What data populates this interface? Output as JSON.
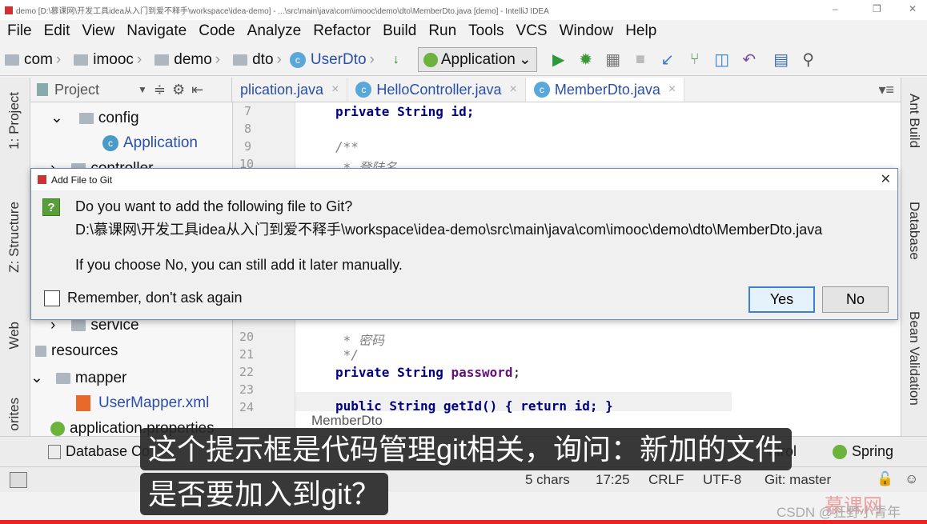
{
  "window": {
    "title": "demo [D:\\慕课网\\开发工具idea从入门到爱不释手\\workspace\\idea-demo] - ...\\src\\main\\java\\com\\imooc\\demo\\dto\\MemberDto.java [demo] - IntelliJ IDEA"
  },
  "menu": [
    "File",
    "Edit",
    "View",
    "Navigate",
    "Code",
    "Analyze",
    "Refactor",
    "Build",
    "Run",
    "Tools",
    "VCS",
    "Window",
    "Help"
  ],
  "breadcrumbs": [
    "com",
    "imooc",
    "demo",
    "dto",
    "UserDto"
  ],
  "run_config": "Application",
  "project_panel": {
    "label": "Project"
  },
  "tabs": [
    {
      "label": "plication.java"
    },
    {
      "label": "HelloController.java"
    },
    {
      "label": "MemberDto.java",
      "active": true
    }
  ],
  "left_stripe": [
    "1: Project",
    "Z: Structure",
    "Web",
    "orites"
  ],
  "right_stripe": [
    "Ant Build",
    "Database",
    "Bean Validation"
  ],
  "tree": [
    {
      "label": "config",
      "kind": "folder"
    },
    {
      "label": "Application",
      "kind": "class"
    },
    {
      "label": "controller",
      "kind": "folder"
    },
    {
      "label": "service",
      "kind": "folder"
    },
    {
      "label": "resources",
      "kind": "folder"
    },
    {
      "label": "mapper",
      "kind": "folder"
    },
    {
      "label": "UserMapper.xml",
      "kind": "xml"
    },
    {
      "label": "application.properties",
      "kind": "properties"
    }
  ],
  "code": {
    "lines": [
      "7",
      "8",
      "9",
      "10",
      "20",
      "21",
      "22",
      "23",
      "24"
    ],
    "l7": "private String id;",
    "l9": "/**",
    "l10": " * 登陆名",
    "l20": " * 密码",
    "l21": " */",
    "l22a": "private String ",
    "l22b": "password",
    ";": ";",
    "l24": "public String getId() { return id; }",
    "breadcrumb": "MemberDto"
  },
  "dialog": {
    "title": "Add File to Git",
    "question": "Do you want to add the following file to Git?",
    "path": "D:\\慕课网\\开发工具idea从入门到爱不释手\\workspace\\idea-demo\\src\\main\\java\\com\\imooc\\demo\\dto\\MemberDto.java",
    "note": "If you choose No, you can still add it later manually.",
    "remember": "Remember, don't ask again",
    "remember_checked": false,
    "yes": "Yes",
    "no": "No"
  },
  "bottom_tools": {
    "database_console": "Database Co",
    "spring": "Spring",
    "control": "ntrol"
  },
  "status": {
    "chars": "5 chars",
    "position": "17:25",
    "line_sep": "CRLF",
    "encoding": "UTF-8",
    "git": "Git: master"
  },
  "subtitle": "这个提示框是代码管理git相关，询问：新加的文件是否要加入到git？",
  "watermark": "CSDN @狂野小青年",
  "logo": "慕课网",
  "colors": {
    "accent": "#3c7fd4",
    "subtitle_bg": "#282828",
    "class_blue": "#2a4fa8"
  }
}
